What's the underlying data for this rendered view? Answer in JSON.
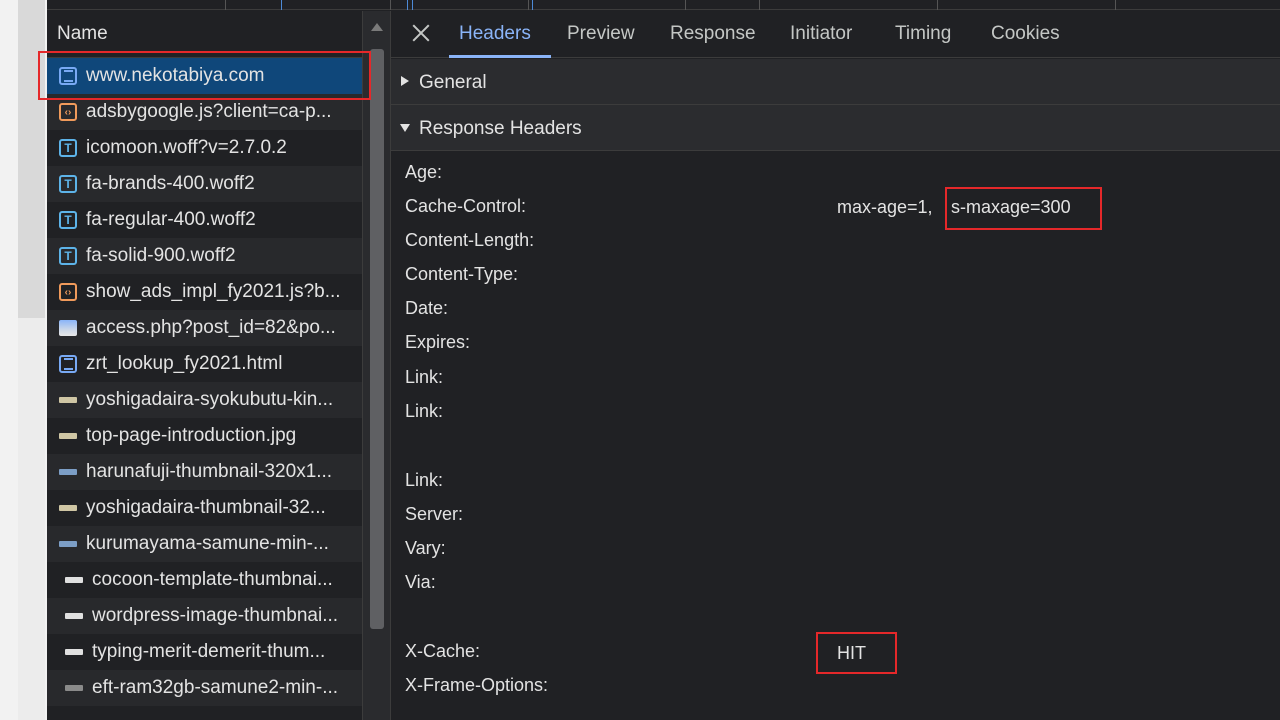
{
  "request_list": {
    "column_header": "Name",
    "rows": [
      {
        "name": "www.nekotabiya.com",
        "icon": "document-icon",
        "type": "doc",
        "selected": true
      },
      {
        "name": "adsbygoogle.js?client=ca-p...",
        "icon": "script-icon",
        "type": "script"
      },
      {
        "name": "icomoon.woff?v=2.7.0.2",
        "icon": "font-icon",
        "type": "font"
      },
      {
        "name": "fa-brands-400.woff2",
        "icon": "font-icon",
        "type": "font"
      },
      {
        "name": "fa-regular-400.woff2",
        "icon": "font-icon",
        "type": "font"
      },
      {
        "name": "fa-solid-900.woff2",
        "icon": "font-icon",
        "type": "font"
      },
      {
        "name": "show_ads_impl_fy2021.js?b...",
        "icon": "script-icon",
        "type": "script"
      },
      {
        "name": "access.php?post_id=82&po...",
        "icon": "image-icon",
        "type": "img"
      },
      {
        "name": "zrt_lookup_fy2021.html",
        "icon": "document-icon",
        "type": "doc"
      },
      {
        "name": "yoshigadaira-syokubutu-kin...",
        "icon": "thumbnail-icon",
        "type": "thumb"
      },
      {
        "name": "top-page-introduction.jpg",
        "icon": "thumbnail-icon",
        "type": "thumb"
      },
      {
        "name": "harunafuji-thumbnail-320x1...",
        "icon": "thumbnail-icon",
        "type": "thumb blue"
      },
      {
        "name": "yoshigadaira-thumbnail-32...",
        "icon": "thumbnail-icon",
        "type": "thumb"
      },
      {
        "name": "kurumayama-samune-min-...",
        "icon": "thumbnail-icon",
        "type": "thumb blue"
      },
      {
        "name": "cocoon-template-thumbnai...",
        "icon": "thumbnail-icon",
        "type": "thumb white"
      },
      {
        "name": "wordpress-image-thumbnai...",
        "icon": "thumbnail-icon",
        "type": "thumb white"
      },
      {
        "name": "typing-merit-demerit-thum...",
        "icon": "thumbnail-icon",
        "type": "thumb white"
      },
      {
        "name": "eft-ram32gb-samune2-min-...",
        "icon": "thumbnail-icon",
        "type": "thumb gray"
      }
    ]
  },
  "tabs": [
    {
      "label": "Headers",
      "active": true
    },
    {
      "label": "Preview"
    },
    {
      "label": "Response"
    },
    {
      "label": "Initiator"
    },
    {
      "label": "Timing"
    },
    {
      "label": "Cookies"
    }
  ],
  "sections": {
    "general": "General",
    "response_headers": "Response Headers"
  },
  "headers": [
    {
      "name": "Age:"
    },
    {
      "name": "Cache-Control:",
      "value_prefix": "max-age=1,",
      "value_highlight": "s-maxage=300"
    },
    {
      "name": "Content-Length:"
    },
    {
      "name": "Content-Type:"
    },
    {
      "name": "Date:"
    },
    {
      "name": "Expires:"
    },
    {
      "name": "Link:"
    },
    {
      "name": "Link:"
    },
    {
      "name": "Link:"
    },
    {
      "name": "Server:"
    },
    {
      "name": "Vary:"
    },
    {
      "name": "Via:"
    },
    {
      "name": "X-Cache:",
      "value_highlight": "HIT"
    },
    {
      "name": "X-Frame-Options:"
    }
  ],
  "colors": {
    "accent": "#8ab4f8",
    "selected_row": "#0f477a",
    "highlight_box": "#e5282a"
  }
}
